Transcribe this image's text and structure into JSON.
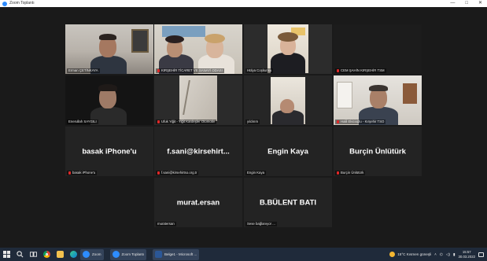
{
  "window": {
    "title": "Zoom Toplantı",
    "controls": [
      "—",
      "□",
      "✕"
    ]
  },
  "participants": [
    {
      "id": "p1",
      "name": "Erman ÇETİNKAYA",
      "muted": false
    },
    {
      "id": "p2",
      "name": "KIRŞEHİR TİCARET VE SANAYİ ODASI",
      "muted": true
    },
    {
      "id": "p3",
      "name": "Hülya Coşkunsu",
      "muted": false
    },
    {
      "id": "p4",
      "name": "CEM ŞAHİN KIRŞEHİR TSM",
      "muted": true
    },
    {
      "id": "p5",
      "name": "Enerullah SAYGILI",
      "muted": false,
      "active": true
    },
    {
      "id": "p6",
      "name": "Ufuk Yiğit - Yiğit Kardeşler Otomotiv",
      "muted": true
    },
    {
      "id": "p7",
      "name": "yıldırım",
      "muted": false
    },
    {
      "id": "p8",
      "name": "Halil Ekicioğlu - Kırşehir TSO",
      "muted": true
    },
    {
      "id": "p9",
      "display": "basak iPhone'u",
      "name": "basak iPhone'u",
      "muted": true
    },
    {
      "id": "p10",
      "display": "f.sani@kirsehirt...",
      "name": "f.sani@kirsehirtso.org.tr",
      "muted": true
    },
    {
      "id": "p11",
      "display": "Engin Kaya",
      "name": "Engin Kaya",
      "muted": false
    },
    {
      "id": "p12",
      "display": "Burçin Ünlütürk",
      "name": "Burçin Ünlütürk",
      "muted": true
    },
    {
      "id": "p13",
      "display": "murat.ersan",
      "name": "muratersan",
      "muted": false
    },
    {
      "id": "p14",
      "display": "B.BÜLENT BATI",
      "name": "Sese bağlanıyor ...",
      "muted": false
    }
  ],
  "taskbar": {
    "apps": [
      {
        "label": "Zoom",
        "open": true
      },
      {
        "label": "Zoom Toplantı",
        "open": true
      },
      {
        "label": "Belge1 - Microsoft ...",
        "open": true
      }
    ],
    "weather": "15°C  Kısmen güneşli",
    "time": "15:57",
    "date": "30.03.2022"
  },
  "colors": {
    "active_outline": "#d7e04a",
    "muted": "#e02828",
    "taskbar": "#1f2a3a"
  }
}
